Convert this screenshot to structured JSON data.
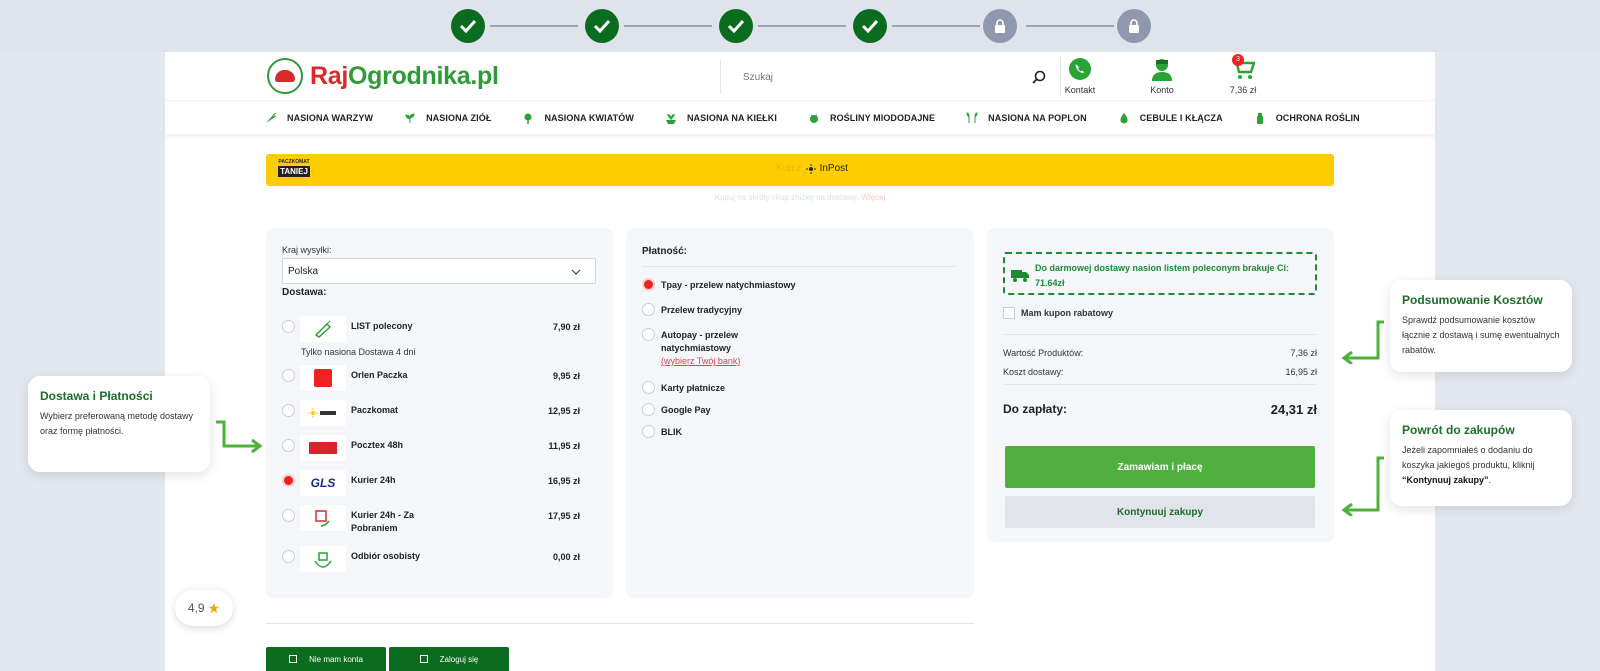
{
  "progress": {
    "steps": [
      "done",
      "done",
      "done",
      "done",
      "locked",
      "locked"
    ]
  },
  "header": {
    "logo_part1": "Raj",
    "logo_part2": "Ogrodnika",
    "logo_part3": ".pl",
    "search_placeholder": "Szukaj",
    "contact_label": "Kontakt",
    "account_label": "Konto",
    "cart_total": "7,36 zł",
    "cart_count": "3"
  },
  "nav": {
    "items": [
      "NASIONA WARZYW",
      "NASIONA ZIÓŁ",
      "NASIONA KWIATÓW",
      "NASIONA NA KIEŁKI",
      "ROŚLINY MIODODAJNE",
      "NASIONA NA POPLON",
      "CEBULE I KŁĄCZA",
      "OCHRONA ROŚLIN"
    ]
  },
  "banner": {
    "logo_top": "PACZKOMAT",
    "logo_bottom": "TANIEJ",
    "center_text": "Kup z",
    "center_brand": "InPost",
    "subtext": "Kupuj na skróty i kup zniżkę na dostawę.",
    "subtext_link": "Więcej"
  },
  "shipping": {
    "country_label": "Kraj wysyłki:",
    "country_value": "Polska",
    "delivery_label": "Dostawa:",
    "note": "Tylko nasiona Dostawa 4 dni",
    "options": [
      {
        "name": "LIST polecony",
        "price": "7,90 zł",
        "checked": false
      },
      {
        "name": "Orlen Paczka",
        "price": "9,95 zł",
        "checked": false
      },
      {
        "name": "Paczkomat",
        "price": "12,95 zł",
        "checked": false
      },
      {
        "name": "Pocztex 48h",
        "price": "11,95 zł",
        "checked": false
      },
      {
        "name": "Kurier 24h",
        "price": "16,95 zł",
        "checked": true
      },
      {
        "name": "Kurier 24h - Za Pobraniem",
        "price": "17,95 zł",
        "checked": false
      },
      {
        "name": "Odbiór osobisty",
        "price": "0,00 zł",
        "checked": false
      }
    ]
  },
  "payment": {
    "title": "Płatność:",
    "options": [
      {
        "name": "Tpay - przelew natychmiastowy",
        "checked": true
      },
      {
        "name": "Przelew tradycyjny",
        "checked": false
      },
      {
        "name": "Autopay - przelew",
        "name2": "natychmiastowy",
        "link": "(wybierz Twój bank)",
        "checked": false
      },
      {
        "name": "Karty płatnicze",
        "checked": false
      },
      {
        "name": "Google Pay",
        "checked": false
      },
      {
        "name": "BLIK",
        "checked": false
      }
    ]
  },
  "summary": {
    "free_shipping_text": "Do darmowej dostawy nasion listem poleconym brakuje Ci: 71.64zł",
    "coupon_label": "Mam kupon rabatowy",
    "products_label": "Wartość Produktów:",
    "products_value": "7,36 zł",
    "shipping_label": "Koszt dostawy:",
    "shipping_value": "16,95 zł",
    "total_label": "Do zapłaty:",
    "total_value": "24,31 zł",
    "order_button": "Zamawiam i płacę",
    "continue_button": "Kontynuuj zakupy"
  },
  "bottom": {
    "no_account_button": "Nie mam konta",
    "login_button": "Zaloguj się"
  },
  "callouts": {
    "delivery_title": "Dostawa i Płatności",
    "delivery_body": "Wybierz preferowaną metodę dostawy oraz formę płatności.",
    "summary_title": "Podsumowanie Kosztów",
    "summary_body": "Sprawdź podsumowanie kosztów łącznie z dostawą i sumę ewentualnych rabatów.",
    "back_title": "Powrót do zakupów",
    "back_body_1": "Jeżeli zapomniałeś o dodaniu do koszyka jakiegoś produktu, kliknij",
    "back_body_bold": "“Kontynuuj zakupy”",
    "back_body_2": "."
  },
  "rating": {
    "value": "4,9"
  },
  "colors": {
    "dark_green": "#0b6b1e",
    "green": "#4fb03d",
    "red": "#e22222",
    "yellow": "#ffcd00"
  }
}
